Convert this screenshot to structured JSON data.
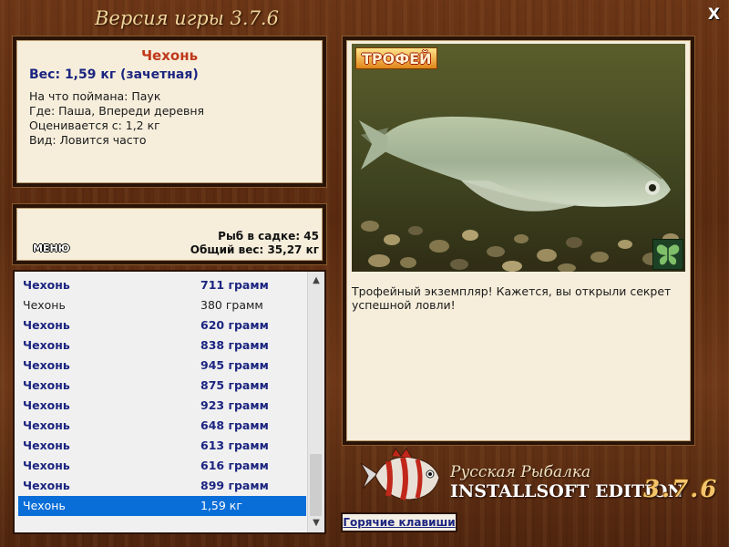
{
  "window": {
    "title": "Версия игры 3.7.6",
    "close_label": "X"
  },
  "fish_info": {
    "name": "Чехонь",
    "weight": "Вес: 1,59 кг (зачетная)",
    "lines": [
      "На что поймана: Паук",
      "Где: Паша, Впереди деревня",
      "Оценивается с: 1,2 кг",
      "Вид: Ловится часто"
    ]
  },
  "cage": {
    "menu_label": "МЕНЮ",
    "fish_count": "Рыб в садке: 45",
    "total_weight": "Общий вес: 35,27 кг"
  },
  "catch_list": {
    "rows": [
      {
        "name": "Чехонь",
        "weight": "711 грамм",
        "style": "hl"
      },
      {
        "name": "Чехонь",
        "weight": "380 грамм",
        "style": "plain"
      },
      {
        "name": "Чехонь",
        "weight": "620 грамм",
        "style": "hl"
      },
      {
        "name": "Чехонь",
        "weight": "838 грамм",
        "style": "hl"
      },
      {
        "name": "Чехонь",
        "weight": "945 грамм",
        "style": "hl"
      },
      {
        "name": "Чехонь",
        "weight": "875 грамм",
        "style": "hl"
      },
      {
        "name": "Чехонь",
        "weight": "923 грамм",
        "style": "hl"
      },
      {
        "name": "Чехонь",
        "weight": "648 грамм",
        "style": "hl"
      },
      {
        "name": "Чехонь",
        "weight": "613 грамм",
        "style": "hl"
      },
      {
        "name": "Чехонь",
        "weight": "616 грамм",
        "style": "hl"
      },
      {
        "name": "Чехонь",
        "weight": "899 грамм",
        "style": "hl"
      },
      {
        "name": "Чехонь",
        "weight": "1,59 кг",
        "style": "selected"
      }
    ],
    "selected_color": "#0a6ed8",
    "highlight_color": "#1c2580"
  },
  "photo": {
    "badge": "ТРОФЕЙ",
    "caption": "Трофейный экземпляр! Кажется, вы открыли секрет успешной ловли!",
    "icon": "butterfly-icon"
  },
  "brand": {
    "line1": "Русская Рыбалка",
    "line2": "INSTALLSOFT EDITION",
    "version": "3.7.6"
  },
  "hotkeys": {
    "label": "Горячие клавиши"
  }
}
